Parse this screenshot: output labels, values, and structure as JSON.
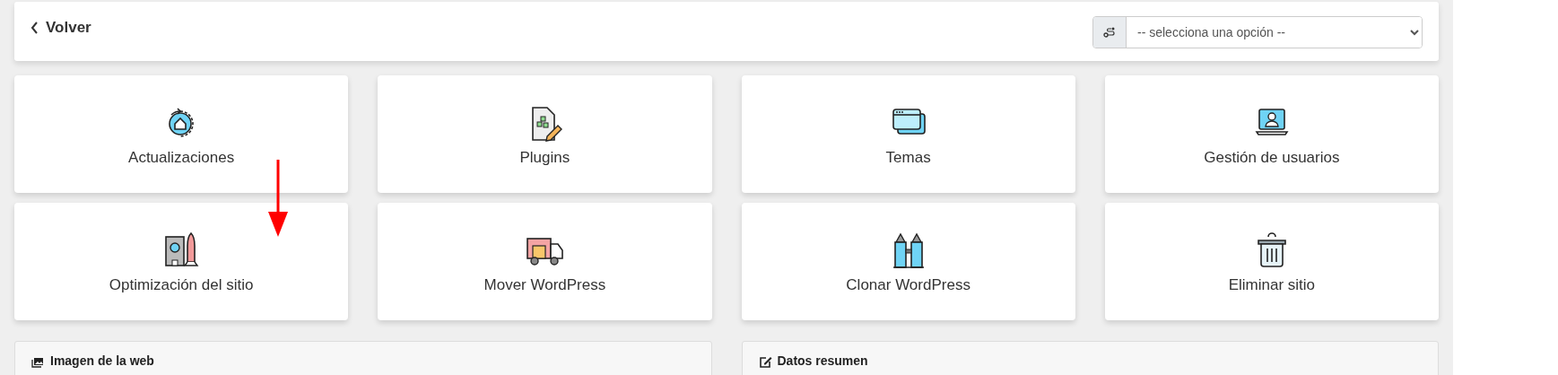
{
  "header": {
    "back_link": "Volver",
    "select": {
      "placeholder": "-- selecciona una opción --"
    }
  },
  "tiles": [
    {
      "label": "Actualizaciones"
    },
    {
      "label": "Plugins"
    },
    {
      "label": "Temas"
    },
    {
      "label": "Gestión de usuarios"
    },
    {
      "label": "Optimización del sitio"
    },
    {
      "label": "Mover WordPress"
    },
    {
      "label": "Clonar WordPress"
    },
    {
      "label": "Eliminar sitio"
    }
  ],
  "panels": [
    {
      "title": "Imagen de la web",
      "kind": "image"
    },
    {
      "title": "Datos resumen",
      "kind": "edit"
    }
  ],
  "annotation": {
    "kind": "arrow"
  }
}
